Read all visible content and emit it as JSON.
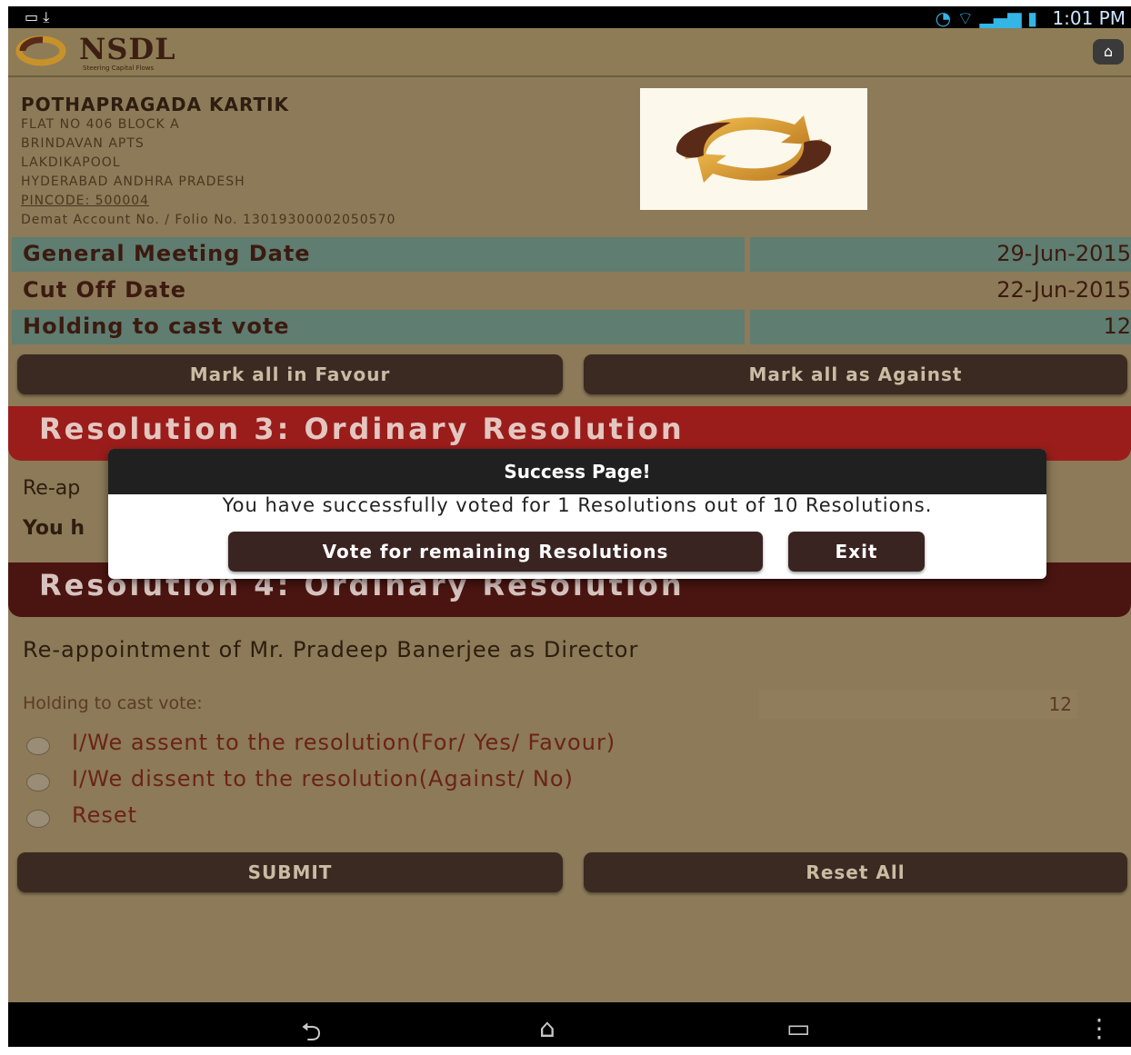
{
  "status_bar": {
    "time": "1:01 PM"
  },
  "header": {
    "brand": "NSDL",
    "brand_sub": "Steering Capital Flows"
  },
  "shareholder": {
    "name": "POTHAPRAGADA KARTIK",
    "address_lines": [
      "FLAT NO 406 BLOCK A",
      "BRINDAVAN APTS",
      "LAKDIKAPOOL",
      "HYDERABAD ANDHRA PRADESH"
    ],
    "pincode": "PINCODE: 500004",
    "account": "Demat Account No. / Folio No. 13019300002050570"
  },
  "meeting": {
    "general_meeting_label": "General Meeting Date",
    "general_meeting_value": "29-Jun-2015",
    "cutoff_label": "Cut Off Date",
    "cutoff_value": "22-Jun-2015",
    "holding_label": "Holding to cast vote",
    "holding_value": "12"
  },
  "bulk_actions": {
    "favour": "Mark all in Favour",
    "against": "Mark all as Against"
  },
  "resolution3": {
    "title": "Resolution 3: Ordinary Resolution",
    "desc_partial": "Re-ap",
    "voted_partial": "You h"
  },
  "resolution4": {
    "title": "Resolution 4: Ordinary Resolution",
    "description": "Re-appointment of Mr. Pradeep Banerjee as Director",
    "holding_label": "Holding to cast vote:",
    "holding_value": "12",
    "options": [
      "I/We assent to the resolution(For/ Yes/ Favour)",
      "I/We dissent to the resolution(Against/ No)",
      "Reset"
    ]
  },
  "form_actions": {
    "submit": "SUBMIT",
    "reset_all": "Reset All"
  },
  "dialog": {
    "title": "Success Page!",
    "message": "You have successfully voted for 1 Resolutions out of 10 Resolutions.",
    "vote_remaining": "Vote for remaining Resolutions",
    "exit": "Exit"
  }
}
